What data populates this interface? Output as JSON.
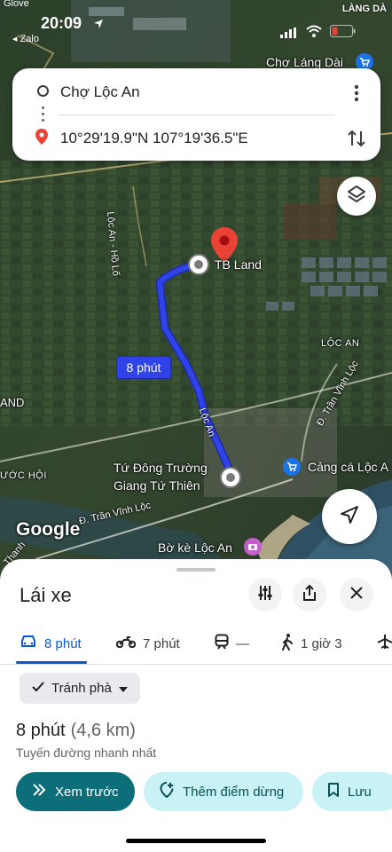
{
  "status_bar": {
    "time": "20:09",
    "back_app": "◂ Zalo",
    "top_left_clip": "Glove",
    "top_right_clip": "LÀNG DÀ"
  },
  "map": {
    "places": {
      "cho_lang_dai": "Chơ Láng Dài",
      "loc_an_ho_lo": "Lộc An - Hồ Lố",
      "tb_land": "TB Land",
      "loc_an_area": "LỘC AN",
      "tran_vinh_loc_1": "Đ. Trần Vĩnh Lộc",
      "and": "AND",
      "loc_an_road": "Lộc An",
      "tu_dong_truong": "Tứ Đông Trường",
      "giang_tu_thien": "Giang Tứ Thiên",
      "cang_ca": "Cảng cá Lộc A",
      "uoc_hoi": "ƯỚC HỘI",
      "tran_vinh_loc_2": "Đ. Trần Vĩnh Lộc",
      "bo_ke": "Bờ kè Lộc An",
      "thanh": "Thanh",
      "google": "Google"
    },
    "route_time_label": "8 phút",
    "route_color": "#2f43e8"
  },
  "route_card": {
    "origin": "Chợ Lộc An",
    "destination": "10°29'19.9\"N 107°19'36.5\"E"
  },
  "sheet": {
    "title": "Lái xe",
    "modes": [
      {
        "label": "8 phút",
        "icon": "car-icon",
        "active": true
      },
      {
        "label": "7 phút",
        "icon": "motorbike-icon",
        "active": false
      },
      {
        "label": "—",
        "icon": "transit-icon",
        "active": false
      },
      {
        "label": "1 giờ 3",
        "icon": "walk-icon",
        "active": false
      }
    ],
    "avoid_chip": "Tránh phà",
    "duration": "8 phút",
    "distance": "(4,6 km)",
    "route_desc": "Tuyến đường nhanh nhất",
    "btn_preview": "Xem trước",
    "btn_add_stop": "Thêm điểm dừng",
    "btn_save": "Lưu"
  },
  "colors": {
    "accent": "#0b57d0",
    "primary_button": "#0b6e78",
    "tonal_button": "#c8f2f5",
    "pin_red": "#ea4335"
  }
}
